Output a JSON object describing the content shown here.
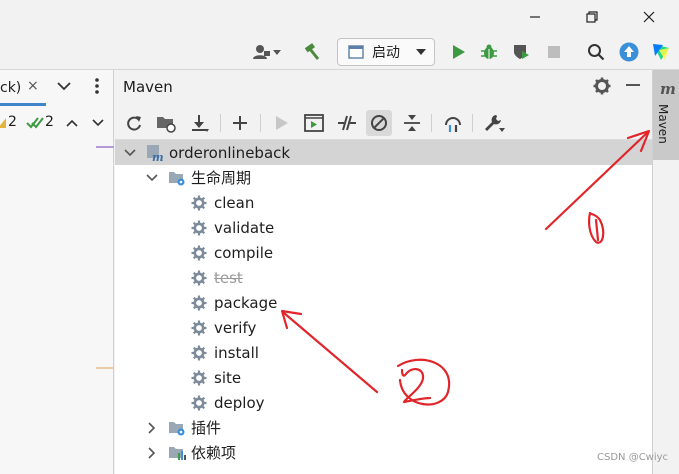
{
  "run_config": {
    "label": "启动"
  },
  "left_panel": {
    "tab_label": "ck)",
    "tab_close": "×",
    "warnings": "2",
    "checks": "2"
  },
  "maven": {
    "title": "Maven",
    "tree": {
      "project": "orderonlineback",
      "lifecycle": "生命周期",
      "phases": [
        "clean",
        "validate",
        "compile",
        "test",
        "package",
        "verify",
        "install",
        "site",
        "deploy"
      ],
      "plugins": "插件",
      "dependencies": "依赖项"
    }
  },
  "right_strip": {
    "m": "m",
    "label": "Maven"
  },
  "annotations": {
    "one": "1",
    "two": "2"
  },
  "watermark": "CSDN @Cwiyc",
  "colors": {
    "annotation": "#e0262b",
    "run_green": "#3c9a42",
    "accent_blue": "#3a8fd9"
  }
}
